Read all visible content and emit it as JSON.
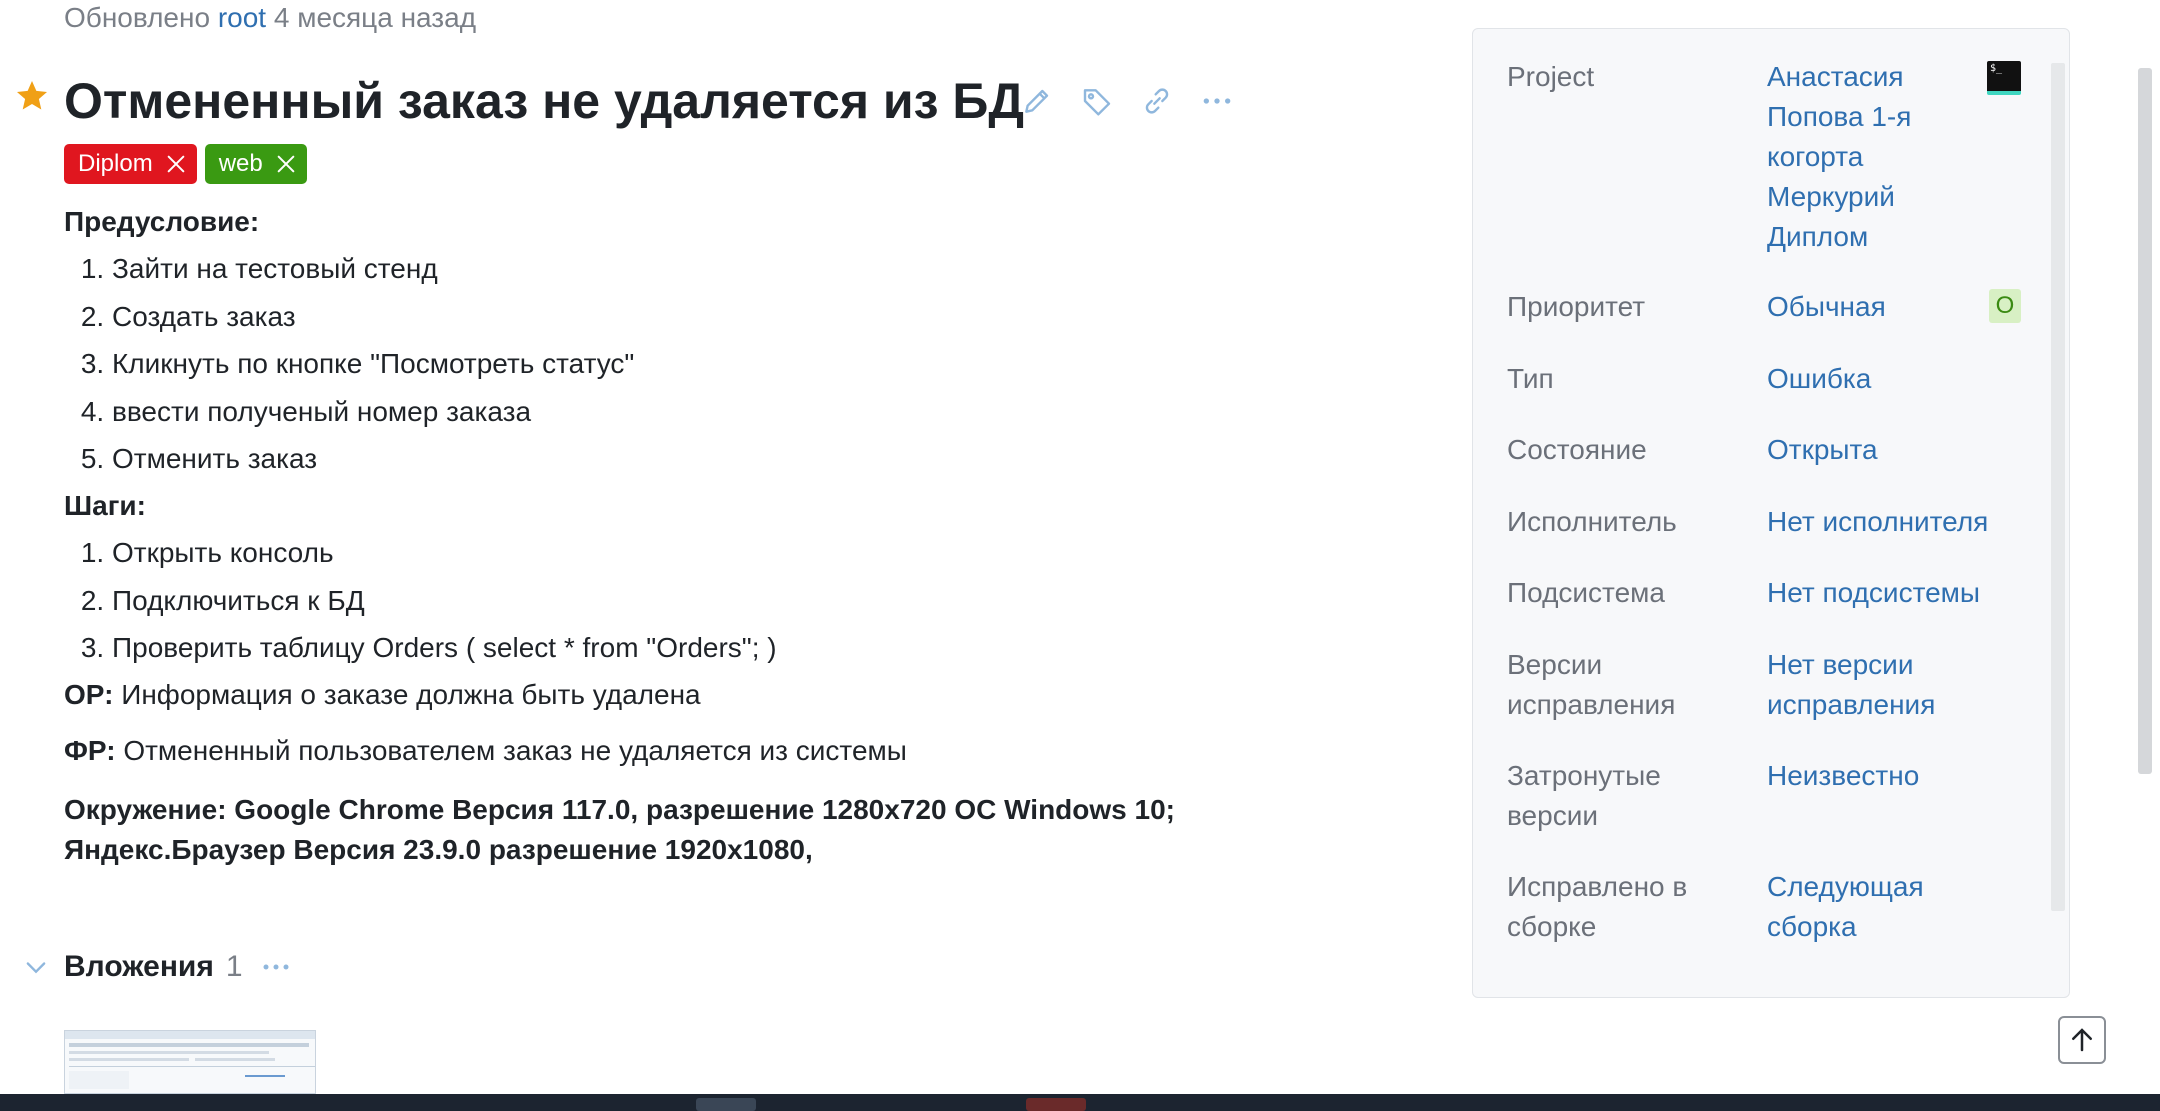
{
  "meta": {
    "updated_prefix": "Обновлено",
    "updated_user": "root",
    "updated_suffix": "4 месяца назад"
  },
  "issue": {
    "title": "Отмененный заказ не удаляется из БД",
    "tags": [
      {
        "label": "Diplom",
        "color": "#e0161f"
      },
      {
        "label": "web",
        "color": "#3a9a12"
      }
    ]
  },
  "description": {
    "precondition_heading": "Предусловие:",
    "preconditions": [
      "Зайти на тестовый стенд",
      "Создать заказ",
      "Кликнуть по кнопке \"Посмотреть статус\"",
      "ввести полученый номер заказа",
      "Отменить заказ"
    ],
    "steps_heading": "Шаги:",
    "steps": [
      "Открыть консоль",
      "Подключиться к БД",
      "Проверить таблицу Orders ( select * from \"Orders\"; )"
    ],
    "expected_label": "ОР:",
    "expected_text": "Информация о заказе должна быть удалена",
    "actual_label": "ФР:",
    "actual_text": "Отмененный пользователем заказ не удаляется из системы",
    "environment_line1": "Окружение: Google Chrome Версия 117.0, разрешение 1280x720 ОС Windows 10;",
    "environment_line2": "Яндекс.Браузер Версия 23.9.0 разрешение 1920x1080,"
  },
  "attachments": {
    "title": "Вложения",
    "count": "1"
  },
  "sidebar": {
    "project_label": "Project",
    "project_value": "Анастасия Попова 1-я когорта Меркурий Диплом",
    "project_icon_text": "$_",
    "priority_label": "Приоритет",
    "priority_value": "Обычная",
    "priority_badge": "О",
    "type_label": "Тип",
    "type_value": "Ошибка",
    "state_label": "Состояние",
    "state_value": "Открыта",
    "assignee_label": "Исполнитель",
    "assignee_value": "Нет исполнителя",
    "subsystem_label": "Подсистема",
    "subsystem_value": "Нет подсистемы",
    "fix_versions_label": "Версии исправления",
    "fix_versions_value": "Нет версии исправления",
    "affected_label": "Затронутые версии",
    "affected_value": "Неизвестно",
    "fixed_in_label": "Исправлено в сборке",
    "fixed_in_value": "Следующая сборка"
  },
  "colors": {
    "link": "#2f6fb0",
    "star": "#f0a016",
    "priority_badge_bg": "#d8f0c4",
    "priority_badge_fg": "#3a8a12"
  }
}
